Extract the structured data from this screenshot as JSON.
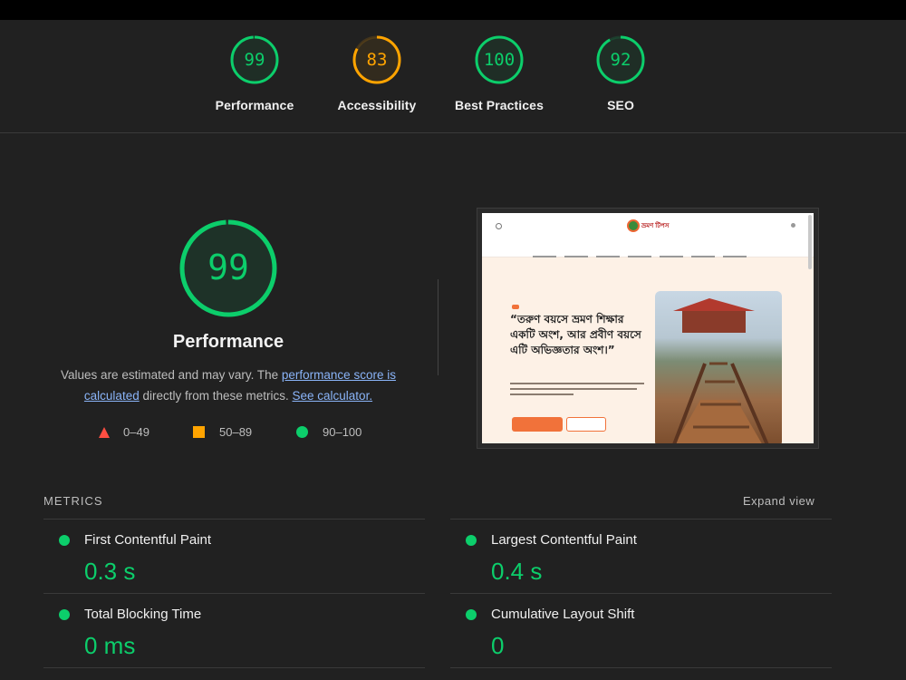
{
  "summary": {
    "gauges": [
      {
        "label": "Performance",
        "score": "99",
        "value": 0.99,
        "color": "#0cce6b"
      },
      {
        "label": "Accessibility",
        "score": "83",
        "value": 0.83,
        "color": "#ffa400"
      },
      {
        "label": "Best Practices",
        "score": "100",
        "value": 1.0,
        "color": "#0cce6b"
      },
      {
        "label": "SEO",
        "score": "92",
        "value": 0.92,
        "color": "#0cce6b"
      }
    ]
  },
  "performance": {
    "score": "99",
    "value": 0.99,
    "title": "Performance",
    "desc_part1": "Values are estimated and may vary. The ",
    "link1": "performance score is calculated",
    "desc_part2": " directly from these metrics. ",
    "link2": "See calculator."
  },
  "legend": [
    {
      "range": "0–49",
      "shape": "triangle",
      "color": "#ff4e42"
    },
    {
      "range": "50–89",
      "shape": "square",
      "color": "#ffa400"
    },
    {
      "range": "90–100",
      "shape": "circle",
      "color": "#0cce6b"
    }
  ],
  "screenshot": {
    "logo": "ভ্রমণ টিপস",
    "headline": "“তরুণ বয়সে ভ্রমণ শিক্ষার একটি অংশ, আর প্রবীণ বয়সে এটি অভিজ্ঞতার অংশ।”"
  },
  "metrics": {
    "heading": "METRICS",
    "expand": "Expand view",
    "items": [
      {
        "name": "First Contentful Paint",
        "value": "0.3 s"
      },
      {
        "name": "Largest Contentful Paint",
        "value": "0.4 s"
      },
      {
        "name": "Total Blocking Time",
        "value": "0 ms"
      },
      {
        "name": "Cumulative Layout Shift",
        "value": "0"
      }
    ]
  },
  "colors": {
    "pass": "#0cce6b",
    "average": "#ffa400",
    "fail": "#ff4e42",
    "background": "#212121"
  }
}
